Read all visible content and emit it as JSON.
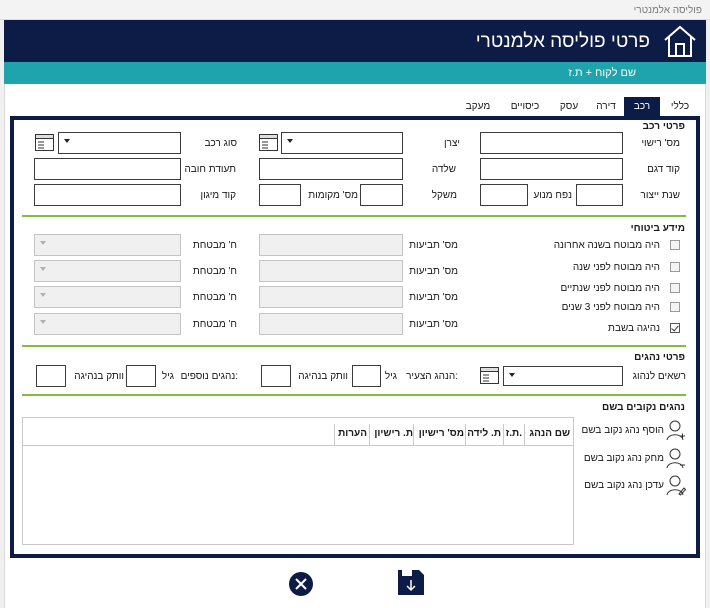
{
  "app": {
    "window_title": "פוליסה אלמנטרי"
  },
  "header": {
    "title": "פרטי פוליסה אלמנטרי",
    "subtitle": "שם לקוח + ת.ז"
  },
  "colors": {
    "navy": "#0d1b47",
    "teal": "#1fa3ad",
    "green": "#82bd3d"
  },
  "tabs": [
    {
      "label": "כללי",
      "active": false
    },
    {
      "label": "רכב",
      "active": true
    },
    {
      "label": "דירה",
      "active": false
    },
    {
      "label": "עסק",
      "active": false
    },
    {
      "label": "כיסויים",
      "active": false
    },
    {
      "label": "מעקב",
      "active": false
    }
  ],
  "vehicle": {
    "section_title": "פרטי רכב",
    "license_no": "מס' רישוי",
    "manufacturer": "יצרן",
    "vehicle_type": "סוג רכב",
    "model_code": "קוד דגם",
    "chassis": "שלדה",
    "compulsory_cert": "תעודת חובה",
    "year": "שנת ייצור",
    "engine_volume": "נפח מנוע",
    "weight": "משקל",
    "seats": "מס' מקומות",
    "protection_code": "קוד מיגון"
  },
  "insurance": {
    "section_title": "מידע ביטוחי",
    "rows": [
      {
        "label": "היה מבוטח בשנה אחרונה",
        "checked": false
      },
      {
        "label": "היה מבוטח לפני שנה",
        "checked": false
      },
      {
        "label": "היה מבוטח לפני שנתיים",
        "checked": false
      },
      {
        "label": "היה מבוטח לפני 3 שנים",
        "checked": false
      },
      {
        "label": "נהיגה בשבת",
        "checked": true
      }
    ],
    "claims_label": "מס' תביעות",
    "insurer_label": "ח' מבטחת"
  },
  "drivers": {
    "section_title": "פרטי נהגים",
    "allowed_label": "רשאים לנהוג",
    "young_driver": "הנהג הצעיר:",
    "age": "גיל",
    "seniority": "וותק בנהיגה",
    "extra_drivers": "נהגים נוספים:"
  },
  "named_drivers": {
    "section_title": "נהגים נקובים בשם",
    "columns": [
      "שם הנהג",
      "ת.ז.",
      "ת. לידה",
      "מס' רישיון",
      "ת. רישיון",
      "הערות"
    ],
    "actions": {
      "add": "הוסף נהג נקוב בשם",
      "delete": "מחק נהג נקוב בשם",
      "update": "עדכן נהג נקוב בשם"
    }
  },
  "icons": {
    "home": "home-icon",
    "calendar": "window-form-icon",
    "close": "close-icon",
    "save": "save-download-icon",
    "user_add": "user-add-icon",
    "user_remove": "user-remove-icon",
    "user_edit": "user-edit-icon"
  }
}
